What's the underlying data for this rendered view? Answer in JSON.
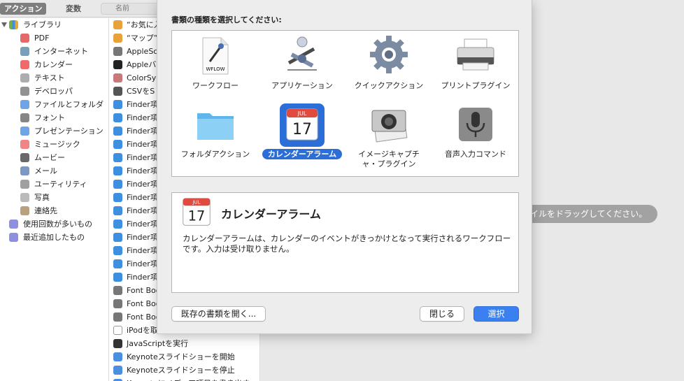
{
  "toolbar": {
    "actions_tab": "アクション",
    "variables_tab": "変数",
    "search_placeholder": "名前"
  },
  "library": {
    "root": "ライブラリ",
    "items": [
      "PDF",
      "インターネット",
      "カレンダー",
      "テキスト",
      "デベロッパ",
      "ファイルとフォルダ",
      "フォント",
      "プレゼンテーション",
      "ミュージック",
      "ムービー",
      "メール",
      "ユーティリティ",
      "写真",
      "連絡先"
    ],
    "groups": [
      "使用回数が多いもの",
      "最近追加したもの"
    ]
  },
  "actions": [
    "“お気に入",
    "“マップ”",
    "AppleSc",
    "Appleバ",
    "ColorSy",
    "CSVをS",
    "Finder項",
    "Finder項",
    "Finder項",
    "Finder項",
    "Finder項",
    "Finder項",
    "Finder項",
    "Finder項",
    "Finder項",
    "Finder項",
    "Finder項",
    "Finder項",
    "Finder項",
    "Finder項",
    "Font Boo",
    "Font Boo",
    "Font Boo",
    "iPodを取",
    "JavaScriptを実行",
    "Keynoteスライドショーを開始",
    "Keynoteスライドショーを停止",
    "Keynoteにメディア項目を書き出す"
  ],
  "docarea": {
    "hint": "イルをドラッグしてください。"
  },
  "sheet": {
    "title": "書類の種類を選択してください:",
    "types": [
      {
        "label": "ワークフロー",
        "icon": "workflow-icon"
      },
      {
        "label": "アプリケーション",
        "icon": "application-icon"
      },
      {
        "label": "クイックアクション",
        "icon": "quick-action-icon"
      },
      {
        "label": "プリントプラグイン",
        "icon": "printer-icon"
      },
      {
        "label": "フォルダアクション",
        "icon": "folder-icon"
      },
      {
        "label": "カレンダーアラーム",
        "icon": "calendar-icon",
        "selected": true
      },
      {
        "label": "イメージキャプチャ・プラグイン",
        "line1": "イメージキャプチ",
        "line2": "ャ・プラグイン",
        "icon": "image-capture-icon"
      },
      {
        "label": "音声入力コマンド",
        "icon": "microphone-icon"
      }
    ],
    "workflow_icon_text": "WFLOW",
    "calendar_month": "JUL",
    "calendar_day": "17",
    "info": {
      "title": "カレンダーアラーム",
      "description": "カレンダーアラームは、カレンダーのイベントがきっかけとなって実行されるワークフローです。入力は受け取りません。"
    },
    "buttons": {
      "open_existing": "既存の書類を開く...",
      "close": "閉じる",
      "choose": "選択"
    }
  },
  "colors": {
    "accent": "#3a80f0",
    "selection": "#2c6ed8"
  }
}
